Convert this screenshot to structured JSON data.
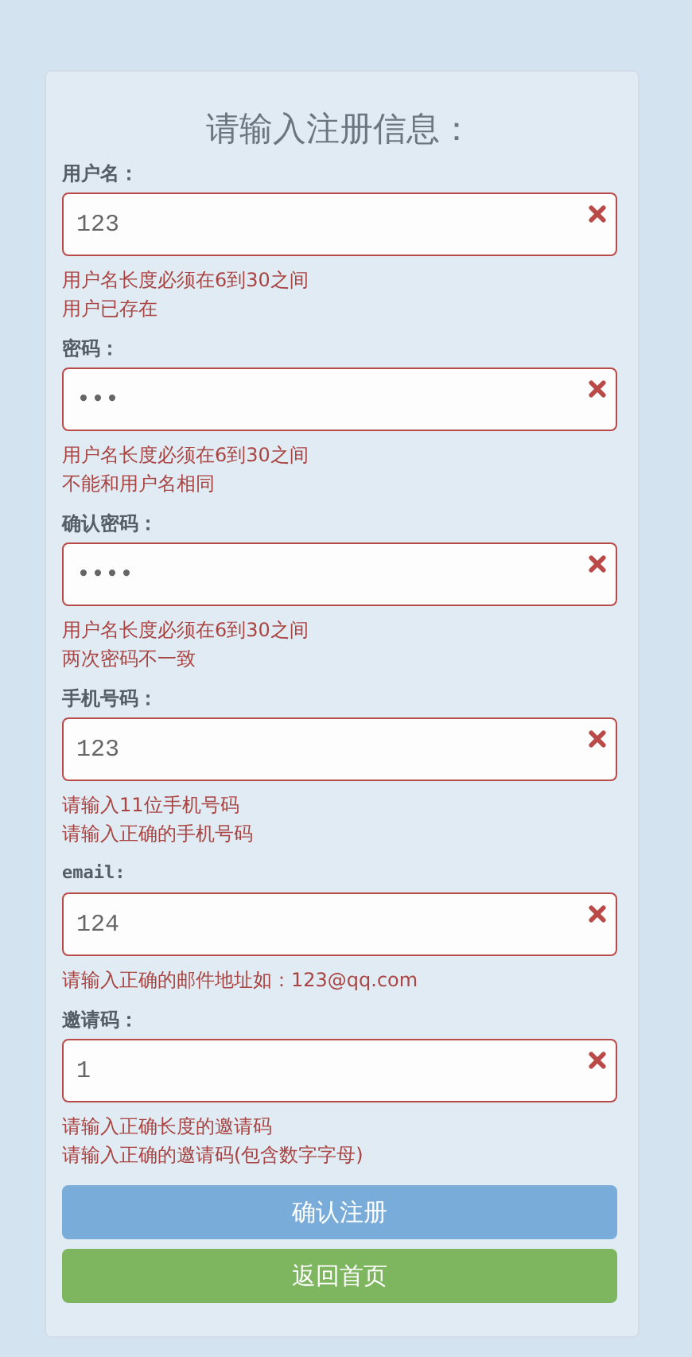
{
  "title": "请输入注册信息：",
  "fields": [
    {
      "kind": "text",
      "label": "用户名：",
      "value": "123",
      "invalid": true,
      "errors": [
        "用户名长度必须在6到30之间",
        "用户已存在"
      ]
    },
    {
      "kind": "text",
      "label": "密码：",
      "value": "•••",
      "invalid": true,
      "errors": [
        "用户名长度必须在6到30之间",
        "不能和用户名相同"
      ]
    },
    {
      "kind": "text",
      "label": "确认密码：",
      "value": "••••",
      "invalid": true,
      "errors": [
        "用户名长度必须在6到30之间",
        "两次密码不一致"
      ]
    },
    {
      "kind": "text",
      "label": "手机号码：",
      "value": "123",
      "invalid": true,
      "errors": [
        "请输入11位手机号码",
        "请输入正确的手机号码"
      ]
    },
    {
      "kind": "mono",
      "label": "email:",
      "value": "124",
      "invalid": true,
      "errors": [
        "请输入正确的邮件地址如：123@qq.com"
      ]
    },
    {
      "kind": "text",
      "label": "邀请码：",
      "value": "1",
      "invalid": true,
      "errors": [
        "请输入正确长度的邀请码",
        "请输入正确的邀请码(包含数字字母)"
      ]
    }
  ],
  "buttons": [
    {
      "kind": "primary",
      "label": "确认注册"
    },
    {
      "kind": "success",
      "label": "返回首页"
    }
  ]
}
